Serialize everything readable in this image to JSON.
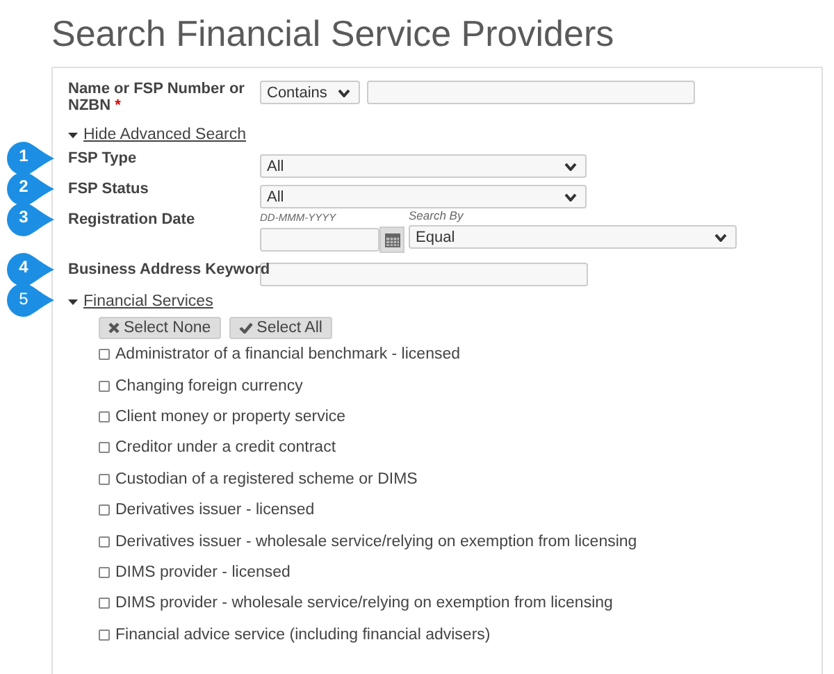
{
  "title": "Search Financial Service Providers",
  "rows": [
    {
      "kind": "name",
      "label": "Name or FSP Number or NZBN",
      "required_mark": "*",
      "operator": "Contains"
    },
    {
      "kind": "toggle",
      "label": "Hide Advanced Search",
      "expanded": true
    },
    {
      "kind": "select",
      "label": "FSP Type",
      "value": "All",
      "callout": "1"
    },
    {
      "kind": "select",
      "label": "FSP Status",
      "value": "All",
      "callout": "2"
    },
    {
      "kind": "date",
      "label": "Registration Date",
      "format_hint": "DD-MMM-YYYY",
      "search_by_label": "Search By",
      "search_by": "Equal",
      "callout": "3"
    },
    {
      "kind": "text",
      "label": "Business Address Keyword",
      "callout": "4"
    },
    {
      "kind": "toggle",
      "label": "Financial Services",
      "expanded": true,
      "callout": "5"
    }
  ],
  "service_buttons": [
    {
      "kind": "none",
      "label": "Select None"
    },
    {
      "kind": "all",
      "label": "Select All"
    }
  ],
  "services": [
    {
      "label": "Administrator of a financial benchmark - licensed",
      "checked": false
    },
    {
      "label": "Changing foreign currency",
      "checked": false
    },
    {
      "label": "Client money or property service",
      "checked": false
    },
    {
      "label": "Creditor under a credit contract",
      "checked": false
    },
    {
      "label": "Custodian of a registered scheme or DIMS",
      "checked": false
    },
    {
      "label": "Derivatives issuer - licensed",
      "checked": false
    },
    {
      "label": "Derivatives issuer - wholesale service/relying on exemption from licensing",
      "checked": false
    },
    {
      "label": "DIMS provider - licensed",
      "checked": false
    },
    {
      "label": "DIMS provider - wholesale service/relying on exemption from licensing",
      "checked": false
    },
    {
      "label": "Financial advice service (including financial advisers)",
      "checked": false
    }
  ]
}
